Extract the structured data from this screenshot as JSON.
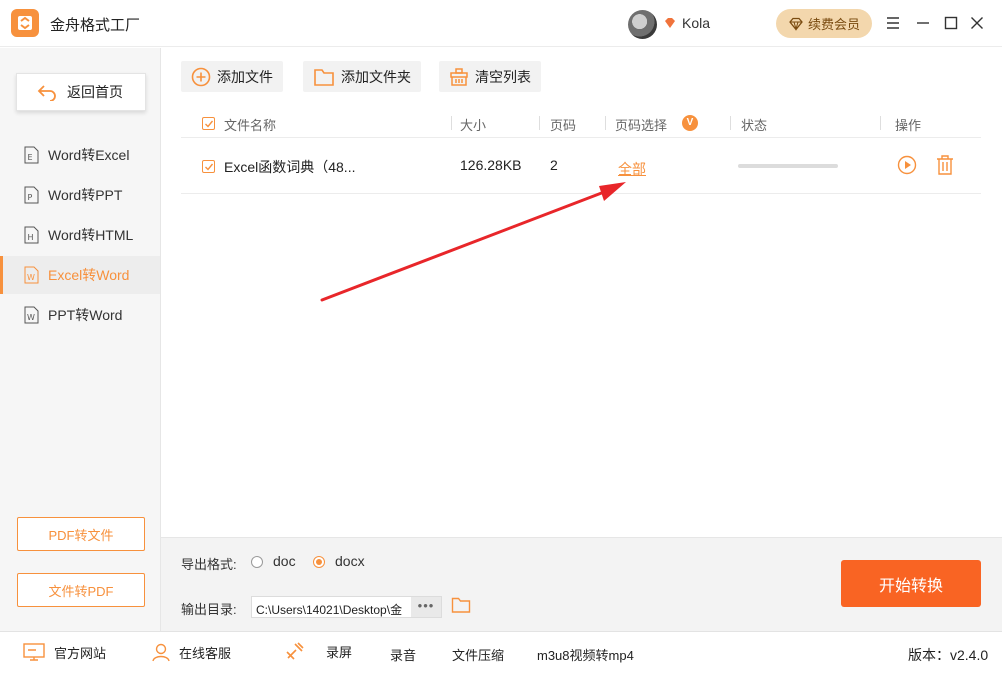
{
  "app": {
    "title": "金舟格式工厂",
    "username": "Kola",
    "renew_label": "续费会员"
  },
  "sidebar": {
    "home_label": "返回首页",
    "items": [
      {
        "label": "Word转Excel",
        "icon": "word-doc-icon",
        "glyph": "E"
      },
      {
        "label": "Word转PPT",
        "icon": "word-doc-icon",
        "glyph": "P"
      },
      {
        "label": "Word转HTML",
        "icon": "word-doc-icon",
        "glyph": "H"
      },
      {
        "label": "Excel转Word",
        "icon": "excel-doc-icon",
        "glyph": "W",
        "active": true
      },
      {
        "label": "PPT转Word",
        "icon": "ppt-doc-icon",
        "glyph": "W"
      }
    ],
    "pdf_to_file_label": "PDF转文件",
    "file_to_pdf_label": "文件转PDF"
  },
  "toolbar": {
    "add_file_label": "添加文件",
    "add_folder_label": "添加文件夹",
    "clear_list_label": "清空列表"
  },
  "table": {
    "headers": {
      "name": "文件名称",
      "size": "大小",
      "pages": "页码",
      "page_select": "页码选择",
      "page_select_badge": "V",
      "status": "状态",
      "actions": "操作"
    },
    "rows": [
      {
        "name": "Excel函数词典（48...",
        "size": "126.28KB",
        "pages": "2",
        "page_select": "全部",
        "progress": 0
      }
    ]
  },
  "output": {
    "format_label": "导出格式:",
    "format_options": [
      "doc",
      "docx"
    ],
    "selected_format": "docx",
    "dir_label": "输出目录:",
    "dir_value": "C:\\Users\\14021\\Desktop\\金",
    "more_label": "•••"
  },
  "start_label": "开始转换",
  "statusbar": {
    "official_site": "官方网站",
    "online_service": "在线客服",
    "screen_record": "录屏",
    "audio_record": "录音",
    "file_compress": "文件压缩",
    "m3u8_convert": "m3u8视频转mp4",
    "version_label": "版本：",
    "version": "v2.4.0"
  },
  "colors": {
    "accent": "#f7913d",
    "start_button": "#f96423",
    "annotation_arrow": "#e8262a"
  }
}
